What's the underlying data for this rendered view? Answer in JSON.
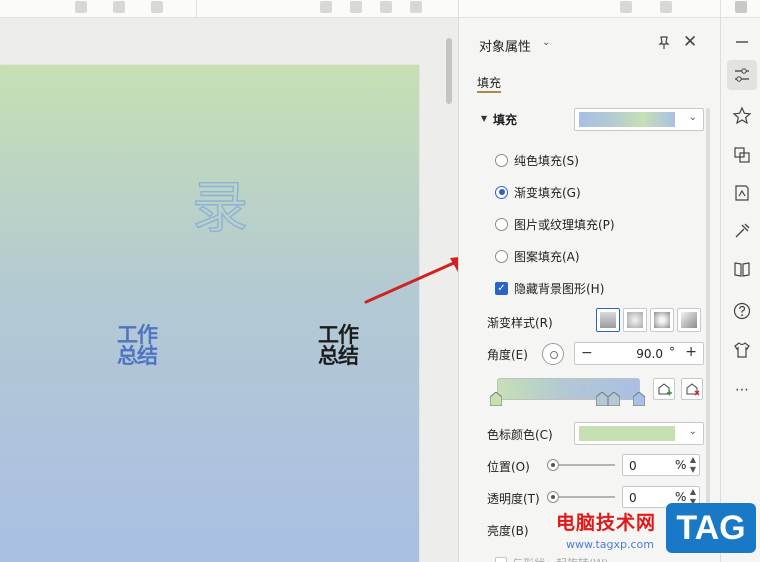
{
  "panel": {
    "title": "对象属性",
    "title_caret": "⌄",
    "close": "✕",
    "tab": "填充",
    "section_label": "填充",
    "fill_options": [
      {
        "label": "纯色填充(S)",
        "selected": false
      },
      {
        "label": "渐变填充(G)",
        "selected": true
      },
      {
        "label": "图片或纹理填充(P)",
        "selected": false
      },
      {
        "label": "图案填充(A)",
        "selected": false
      }
    ],
    "hide_bg": {
      "label": "隐藏背景图形(H)",
      "checked": true,
      "mark": "✓"
    },
    "gradient_style_label": "渐变样式(R)",
    "angle": {
      "label": "角度(E)",
      "minus": "−",
      "value": "90.0",
      "unit": "°",
      "plus": "+"
    },
    "stop_color_label": "色标颜色(C)",
    "position": {
      "label": "位置(O)",
      "value": "0",
      "unit": "%"
    },
    "transparency": {
      "label": "透明度(T)",
      "value": "0",
      "unit": "%"
    },
    "brightness_label": "亮度(B)",
    "rotate_with_shape": "与形状一起旋转(W)",
    "spin_up": "▲",
    "spin_down": "▼"
  },
  "slide": {
    "big_char": "录",
    "blue_text_line1": "工作",
    "blue_text_line2": "总结",
    "dark_text_line1": "工作",
    "dark_text_line2": "总结"
  },
  "rail_icons": [
    "minimize-icon",
    "properties-icon",
    "star-icon",
    "swap-icon",
    "reading-icon",
    "tools-icon",
    "book-icon",
    "help-icon",
    "shirt-icon",
    "more-icon"
  ],
  "rail_more": "⋯",
  "watermark": {
    "text": "电脑技术网",
    "url": "www.tagxp.com",
    "tag": "TAG"
  },
  "colors": {
    "gradient_start": "#c6e0b4",
    "gradient_mid": "#b3c9d3",
    "gradient_end": "#a9bfe4",
    "accent": "#2b63c8",
    "arrow": "#d32020"
  }
}
